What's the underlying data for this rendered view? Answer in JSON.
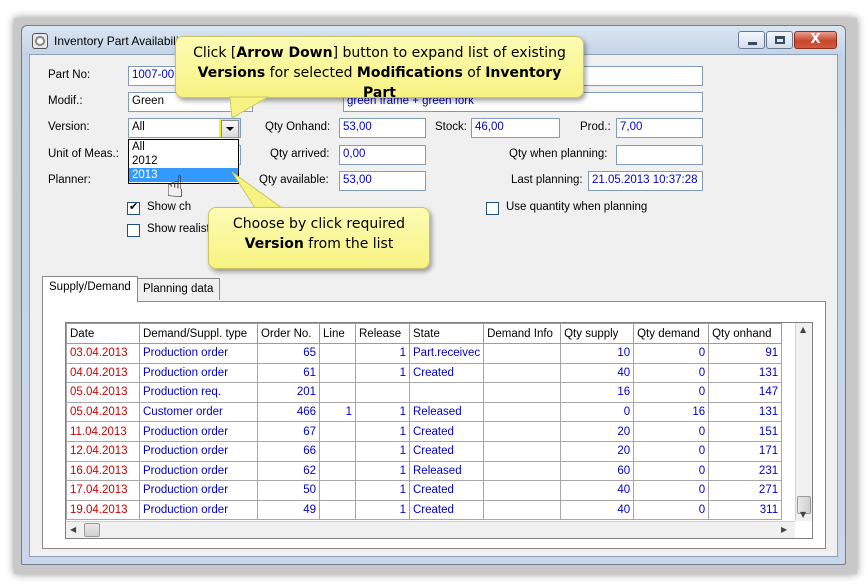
{
  "window": {
    "title": "Inventory Part Availability",
    "buttons": {
      "minimize": "",
      "maximize": "",
      "close": "X"
    }
  },
  "form": {
    "part_no": {
      "label": "Part No:",
      "value": "1007-00"
    },
    "modif": {
      "label": "Modif.:",
      "value": "Green",
      "desc_value": "green frame + green fork"
    },
    "version": {
      "label": "Version:",
      "value": "All"
    },
    "unit": {
      "label": "Unit of Meas.:"
    },
    "planner": {
      "label": "Planner:"
    },
    "qty_onhand": {
      "label": "Qty Onhand:",
      "value": "53,00"
    },
    "stock": {
      "label": "Stock:",
      "value": "46,00"
    },
    "prod": {
      "label": "Prod.:",
      "value": "7,00"
    },
    "qty_arrived": {
      "label": "Qty arrived:",
      "value": "0,00"
    },
    "qty_when_planning": {
      "label": "Qty when planning:",
      "value": ""
    },
    "qty_available": {
      "label": "Qty available:",
      "value": "53,00"
    },
    "last_planning": {
      "label": "Last planning:",
      "value": "21.05.2013 10:37:28"
    },
    "show_ch": {
      "label": "Show ch",
      "checked": true
    },
    "show_realist": {
      "label": "Show realist",
      "checked": false
    },
    "use_qty_planning": {
      "label": "Use quantity when planning",
      "checked": false
    }
  },
  "version_dropdown": {
    "options": [
      "All",
      "2012",
      "2013"
    ],
    "selected": "2013"
  },
  "tabs": [
    {
      "label": "Supply/Demand",
      "active": true
    },
    {
      "label": "Planning data",
      "active": false
    }
  ],
  "grid": {
    "columns": [
      "Date",
      "Demand/Suppl. type",
      "Order No.",
      "Line",
      "Release",
      "State",
      "Demand Info",
      "Qty supply",
      "Qty demand",
      "Qty onhand"
    ],
    "rows": [
      [
        "03.04.2013",
        "Production order",
        "65",
        "",
        "1",
        "Part.receivec",
        "",
        "10",
        "0",
        "91"
      ],
      [
        "04.04.2013",
        "Production order",
        "61",
        "",
        "1",
        "Created",
        "",
        "40",
        "0",
        "131"
      ],
      [
        "05.04.2013",
        "Production req.",
        "201",
        "",
        "",
        "",
        "",
        "16",
        "0",
        "147"
      ],
      [
        "05.04.2013",
        "Customer order",
        "466",
        "1",
        "1",
        "Released",
        "",
        "0",
        "16",
        "131"
      ],
      [
        "11.04.2013",
        "Production order",
        "67",
        "",
        "1",
        "Created",
        "",
        "20",
        "0",
        "151"
      ],
      [
        "12.04.2013",
        "Production order",
        "66",
        "",
        "1",
        "Created",
        "",
        "20",
        "0",
        "171"
      ],
      [
        "16.04.2013",
        "Production order",
        "62",
        "",
        "1",
        "Released",
        "",
        "60",
        "0",
        "231"
      ],
      [
        "17.04.2013",
        "Production order",
        "50",
        "",
        "1",
        "Created",
        "",
        "40",
        "0",
        "271"
      ],
      [
        "19.04.2013",
        "Production order",
        "49",
        "",
        "1",
        "Created",
        "",
        "40",
        "0",
        "311"
      ]
    ]
  },
  "callouts": {
    "top": {
      "line1_a": "Click [",
      "line1_b": "Arrow Down",
      "line1_c": "] button to expand list of existing",
      "line2_a": "Versions",
      "line2_b": " for selected ",
      "line2_c": "Modifications",
      "line2_d": " of ",
      "line2_e": "Inventory Part"
    },
    "bottom": {
      "line1": "Choose by click required",
      "line2_a": "Version",
      "line2_b": " from the list"
    }
  },
  "colors": {
    "blue_text": "#0000cc",
    "red_date": "#cc0000",
    "callout": "#f7f382",
    "selection": "#3399ff"
  }
}
